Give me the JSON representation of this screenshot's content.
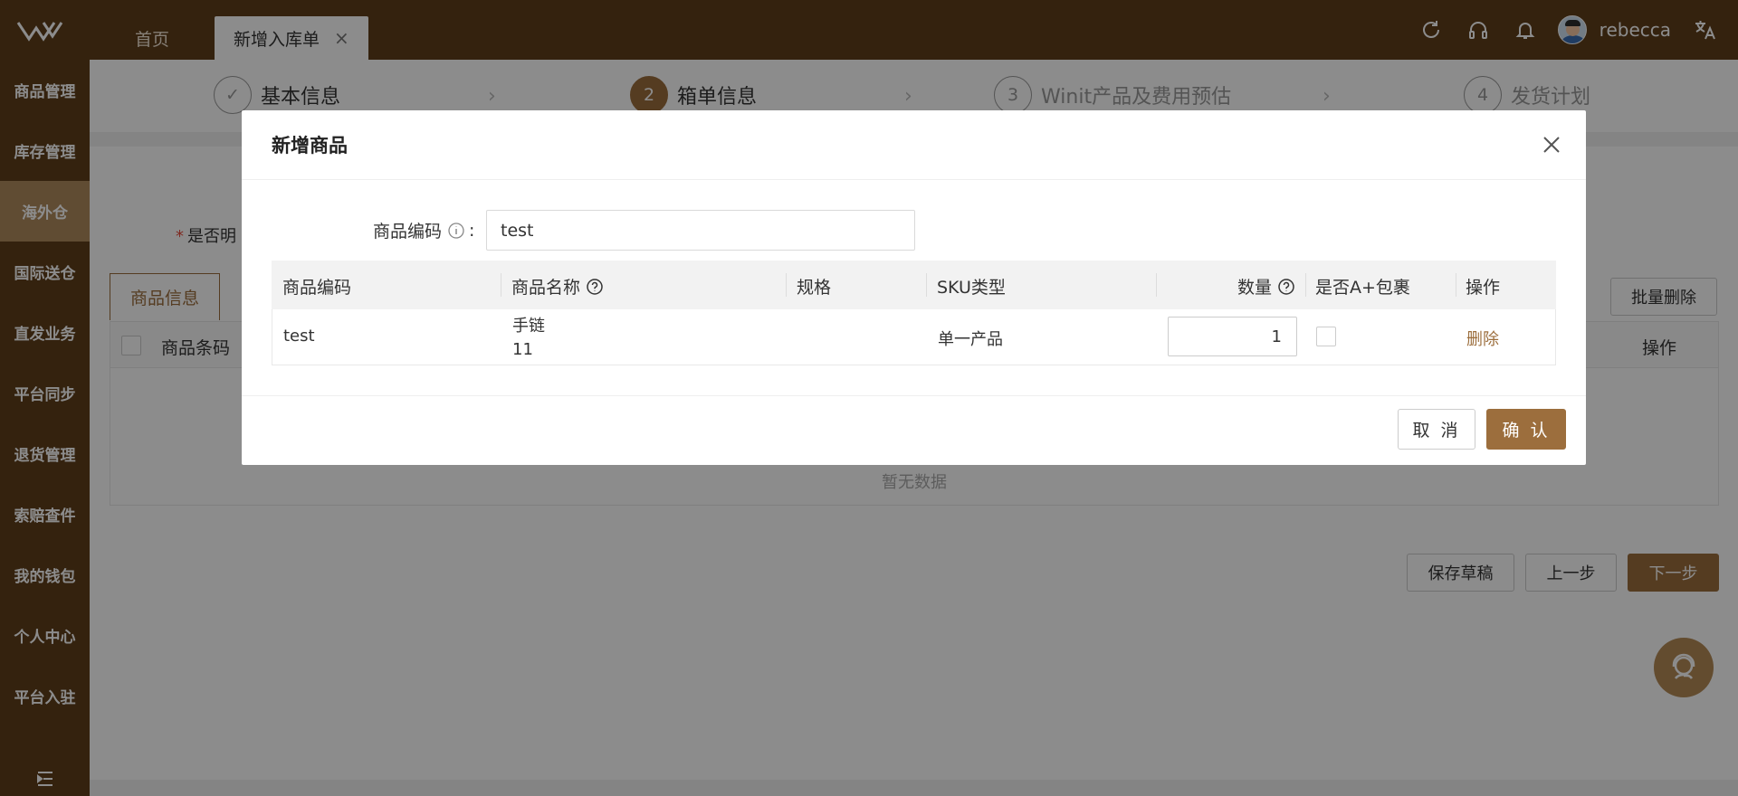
{
  "header": {
    "logo_icon": "winit-logo-icon",
    "tabs": [
      {
        "label": "首页"
      },
      {
        "label": "新增入库单",
        "close": "×"
      }
    ],
    "icons": [
      "refresh-icon",
      "headset-icon",
      "bell-icon"
    ],
    "user": {
      "name": "rebecca"
    },
    "translate_icon": "translate-icon"
  },
  "sidebar": {
    "items": [
      {
        "label": "商品管理"
      },
      {
        "label": "库存管理"
      },
      {
        "label": "海外仓"
      },
      {
        "label": "国际送仓"
      },
      {
        "label": "直发业务"
      },
      {
        "label": "平台同步"
      },
      {
        "label": "退货管理"
      },
      {
        "label": "索赔查件"
      },
      {
        "label": "我的钱包"
      },
      {
        "label": "个人中心"
      },
      {
        "label": "平台入驻"
      }
    ],
    "active_index": 2,
    "collapse_icon": "menu-collapse-icon"
  },
  "steps": [
    {
      "num": "✓",
      "label": "基本信息",
      "state": "done"
    },
    {
      "num": "2",
      "label": "箱单信息",
      "state": "current"
    },
    {
      "num": "3",
      "label": "Winit产品及费用预估",
      "state": "todo"
    },
    {
      "num": "4",
      "label": "发货计划",
      "state": "todo"
    }
  ],
  "background": {
    "required_label": "是否明",
    "sub_tab": "商品信息",
    "batch_delete": "批量删除",
    "table_headers": {
      "barcode": "商品条码",
      "action": "操作"
    },
    "empty_text": "暂无数据",
    "buttons": {
      "save_draft": "保存草稿",
      "prev": "上一步",
      "next": "下一步"
    }
  },
  "modal": {
    "title": "新增商品",
    "search": {
      "label": "商品编码",
      "suffix": ":",
      "value": "test"
    },
    "table": {
      "headers": {
        "code": "商品编码",
        "name": "商品名称",
        "spec": "规格",
        "sku_type": "SKU类型",
        "qty": "数量",
        "a_plus": "是否A+包裹",
        "action": "操作"
      },
      "rows": [
        {
          "code": "test",
          "name_line1": "手链",
          "name_line2": "11",
          "spec": "",
          "sku_type": "单一产品",
          "qty": "1",
          "a_plus_checked": false,
          "action": "删除"
        }
      ]
    },
    "buttons": {
      "cancel": "取 消",
      "confirm": "确 认"
    }
  },
  "colors": {
    "brand_dark": "#5f3e1b",
    "brand_accent": "#9c6e3d",
    "sidebar_active": "#b08a5d"
  }
}
